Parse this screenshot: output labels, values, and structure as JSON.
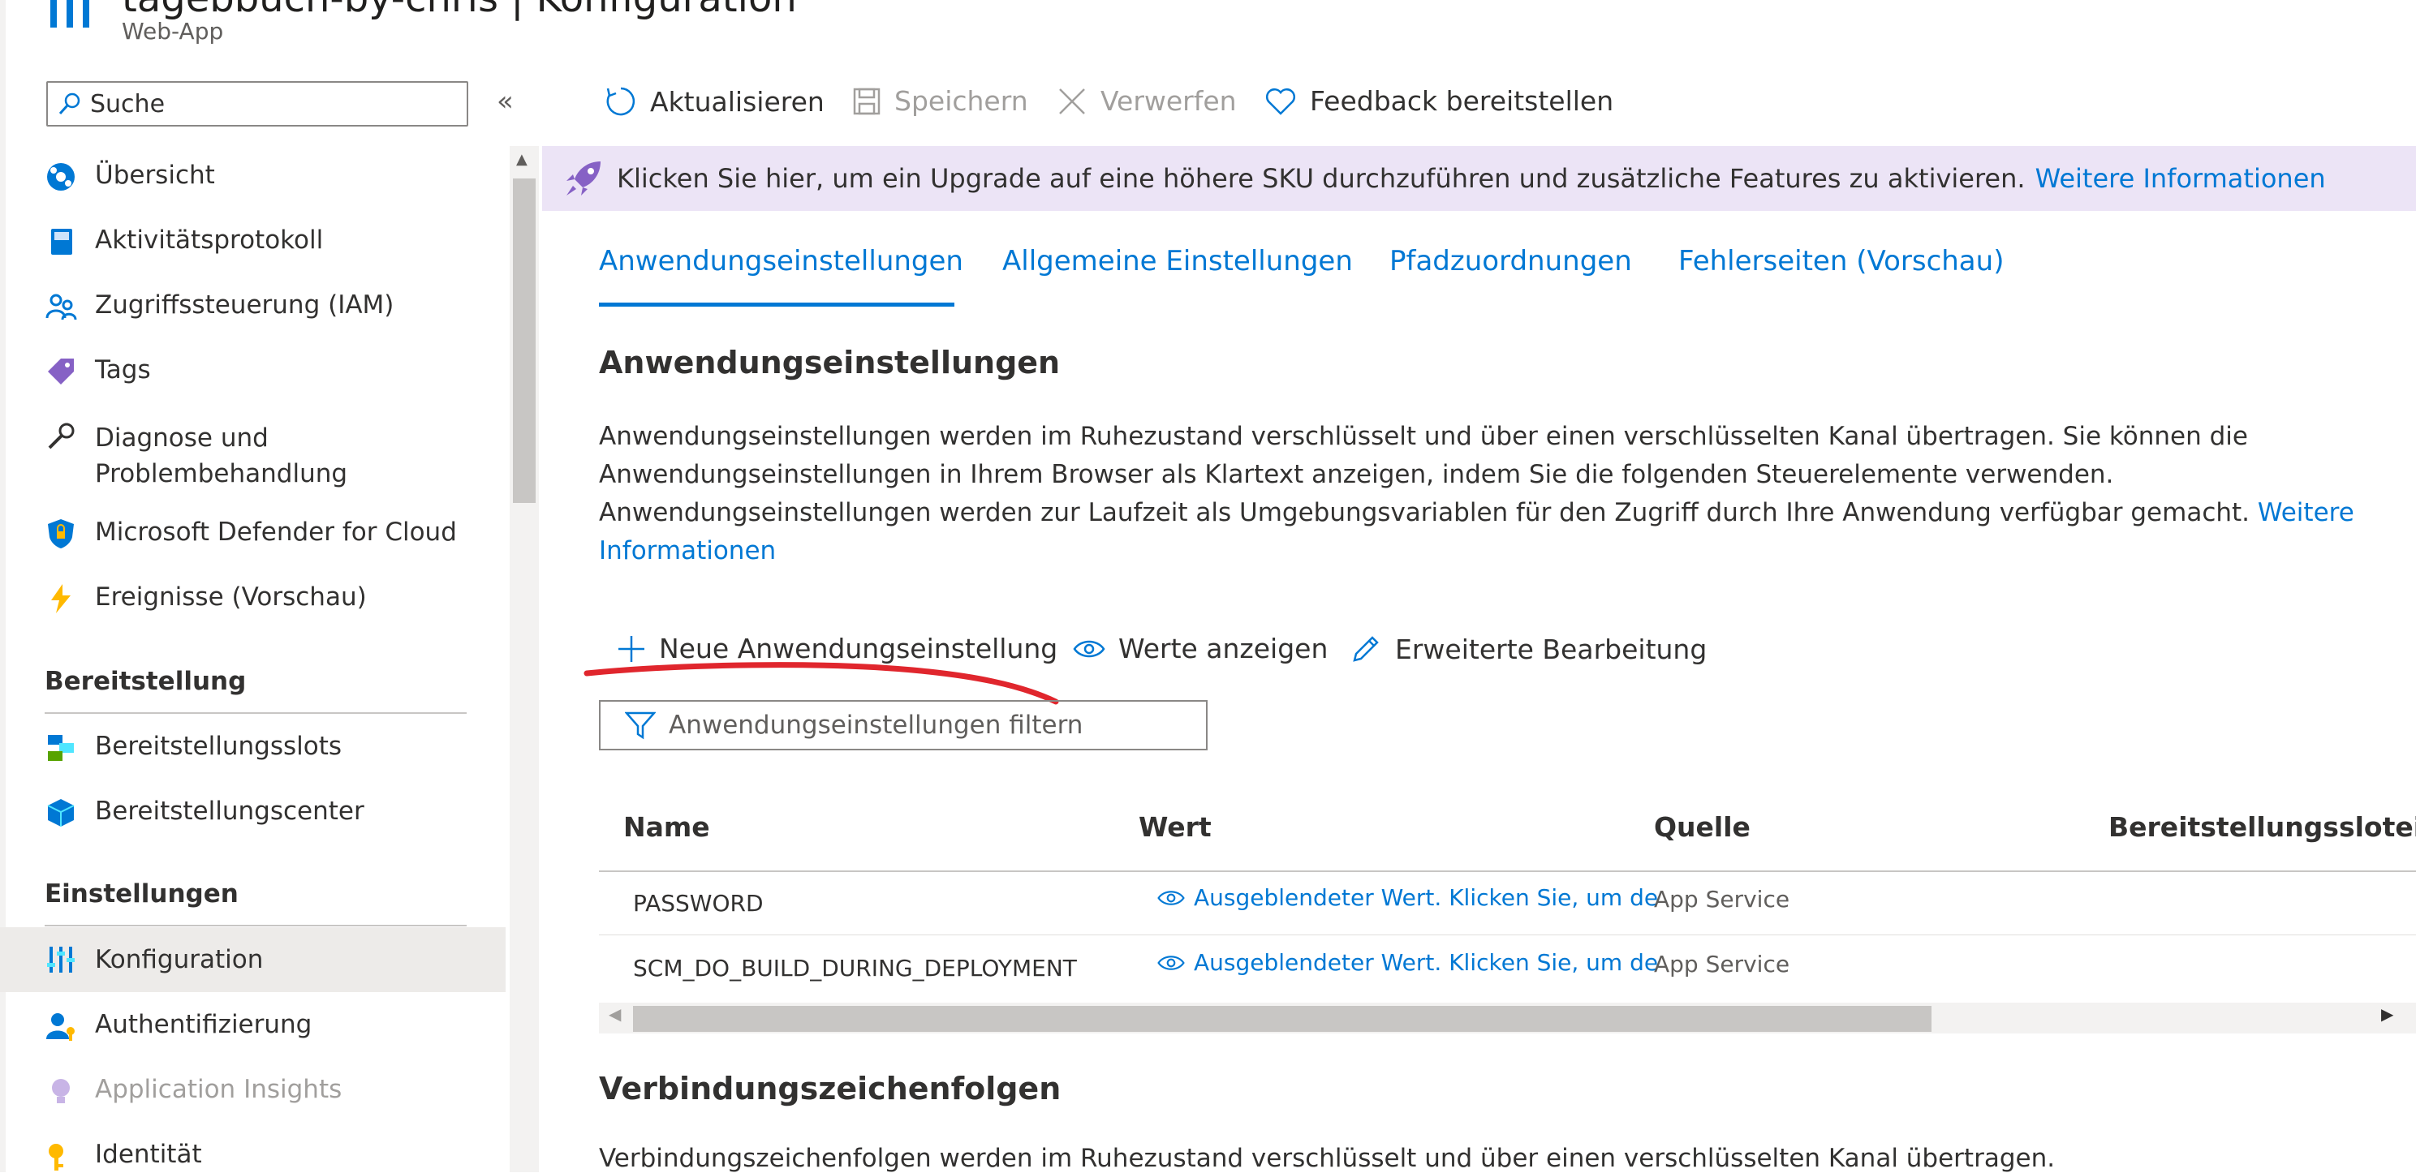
{
  "header": {
    "title": "tagebbuch-by-chris | Konfiguration",
    "subtitle": "Web-App"
  },
  "sidebar": {
    "search_placeholder": "Suche",
    "collapse_label": "«",
    "items": [
      {
        "label": "Übersicht",
        "icon": "globe-icon"
      },
      {
        "label": "Aktivitätsprotokoll",
        "icon": "log-icon"
      },
      {
        "label": "Zugriffssteuerung (IAM)",
        "icon": "people-icon"
      },
      {
        "label": "Tags",
        "icon": "tag-icon"
      },
      {
        "label": "Diagnose und Problembehandlung",
        "icon": "wrench-icon"
      },
      {
        "label": "Microsoft Defender for Cloud",
        "icon": "shield-icon"
      },
      {
        "label": "Ereignisse (Vorschau)",
        "icon": "lightning-icon"
      }
    ],
    "section_bereitstellung": {
      "title": "Bereitstellung",
      "items": [
        {
          "label": "Bereitstellungsslots",
          "icon": "slots-icon"
        },
        {
          "label": "Bereitstellungscenter",
          "icon": "cube-icon"
        }
      ]
    },
    "section_einstellungen": {
      "title": "Einstellungen",
      "items": [
        {
          "label": "Konfiguration",
          "icon": "sliders-icon",
          "active": true
        },
        {
          "label": "Authentifizierung",
          "icon": "user-key-icon"
        },
        {
          "label": "Application Insights",
          "icon": "bulb-icon",
          "disabled": true
        },
        {
          "label": "Identität",
          "icon": "key-icon"
        }
      ]
    }
  },
  "commands": {
    "refresh": "Aktualisieren",
    "save": "Speichern",
    "discard": "Verwerfen",
    "feedback": "Feedback bereitstellen"
  },
  "banner": {
    "text": "Klicken Sie hier, um ein Upgrade auf eine höhere SKU durchzuführen und zusätzliche Features zu aktivieren.",
    "link": "Weitere Informationen"
  },
  "tabs": [
    {
      "label": "Anwendungseinstellungen",
      "active": true
    },
    {
      "label": "Allgemeine Einstellungen"
    },
    {
      "label": "Pfadzuordnungen"
    },
    {
      "label": "Fehlerseiten (Vorschau)"
    }
  ],
  "app_settings": {
    "heading": "Anwendungseinstellungen",
    "description": "Anwendungseinstellungen werden im Ruhezustand verschlüsselt und über einen verschlüsselten Kanal übertragen. Sie können die Anwendungseinstellungen in Ihrem Browser als Klartext anzeigen, indem Sie die folgenden Steuerelemente verwenden. Anwendungseinstellungen werden zur Laufzeit als Umgebungsvariablen für den Zugriff durch Ihre Anwendung verfügbar gemacht.",
    "description_link": "Weitere Informationen",
    "toolbar": {
      "new": "Neue Anwendungseinstellung",
      "show_values": "Werte anzeigen",
      "advanced_edit": "Erweiterte Bearbeitung"
    },
    "filter_placeholder": "Anwendungseinstellungen filtern",
    "columns": [
      "Name",
      "Wert",
      "Quelle",
      "Bereitstellungssloteinst"
    ],
    "rows": [
      {
        "name": "PASSWORD",
        "value": "Ausgeblendeter Wert. Klicken Sie, um de",
        "source": "App Service"
      },
      {
        "name": "SCM_DO_BUILD_DURING_DEPLOYMENT",
        "value": "Ausgeblendeter Wert. Klicken Sie, um de",
        "source": "App Service"
      }
    ]
  },
  "connection_strings": {
    "heading": "Verbindungszeichenfolgen",
    "description": "Verbindungszeichenfolgen werden im Ruhezustand verschlüsselt und über einen verschlüsselten Kanal übertragen."
  },
  "colors": {
    "accent": "#0078d4",
    "banner_bg": "#ece4f6",
    "annotation": "#e0262d"
  }
}
